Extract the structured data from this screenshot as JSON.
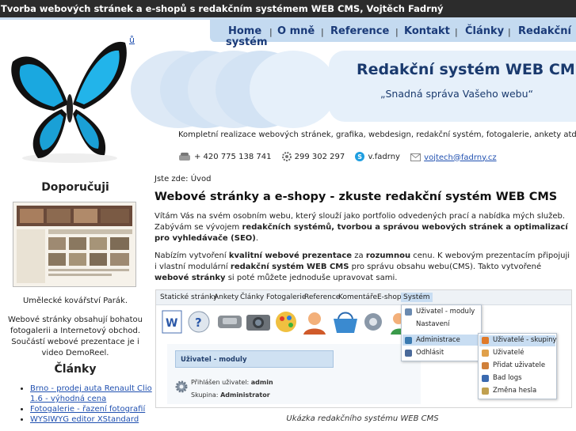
{
  "window": {
    "title": "Tvorba webových stránek a e-shopů s redakčním systémem WEB CMS, Vojtěch Fadrný"
  },
  "nav": {
    "items": [
      "Home",
      "O mně",
      "Reference",
      "Kontakt",
      "Články",
      "Redakční",
      "systém"
    ]
  },
  "header": {
    "small_mark": "ů",
    "hero_title": "Redakční systém WEB CMS",
    "hero_subtitle": "„Snadná správa Vašeho webu“",
    "tagline": "Kompletní realizace webových stránek, grafika, webdesign, redakční systém, fotogalerie, ankety atd.",
    "contacts": {
      "phone": "+ 420 775 138 741",
      "icq": "299 302 297",
      "skype": "v.fadrny",
      "email": "vojtech@fadrny.cz"
    }
  },
  "sidebar": {
    "recommend_title": "Doporučuji",
    "thumb_caption": "Umělecké kovářství Parák.",
    "thumb_desc": "Webové stránky obsahují bohatou fotogalerii a Internetový obchod. Součástí webové prezentace je i video DemoReel.",
    "articles_title": "Články",
    "articles": [
      "Brno - prodej auta Renault Clio 1.6 - výhodná cena",
      "Fotogalerie - řazení fotografií",
      "WYSIWYG editor XStandard"
    ]
  },
  "main": {
    "breadcrumb": "Jste zde: Úvod",
    "heading": "Webové stránky a e-shopy - zkuste redakční systém WEB CMS",
    "p1": {
      "a": "Vítám Vás na svém osobním webu, který slouží jako portfolio odvedených prací a nabídka mých služeb. Zabývám se vývojem ",
      "b": "redakčních systémů, tvorbou a správou webových stránek a optimalizací pro vyhledávače (SEO)",
      "c": "."
    },
    "p2": {
      "a": "Nabízím vytvoření ",
      "b": "kvalitní webové prezentace",
      "c": " za ",
      "d": "rozumnou",
      "e": " cenu. K webovým prezentacím připojuji i vlastní modulární ",
      "f": "redakční systém WEB CMS",
      "g": " pro správu obsahu webu(CMS). Takto vytvořené ",
      "h": "webové stránky",
      "i": " si poté můžete jednoduše upravovat sami."
    },
    "screenshot": {
      "menu": [
        "Statické stránky",
        "Ankety",
        "Články",
        "Fotogalerie",
        "Reference",
        "Komentáře",
        "E-shop",
        "Systém"
      ],
      "panel_header": "Uživatel - moduly",
      "logged_label": "Přihlášen uživatel:",
      "logged_value": "admin",
      "group_label": "Skupina:",
      "group_value": "Administrator",
      "dropdown1": [
        "Uživatel - moduly",
        "Nastavení",
        "Administrace",
        "Odhlásit"
      ],
      "dropdown2": [
        "Uživatelé - skupiny",
        "Uživatelé",
        "Přidat uživatele",
        "Bad logs",
        "Změna hesla"
      ]
    },
    "caption": "Ukázka redakčního systému WEB CMS"
  }
}
